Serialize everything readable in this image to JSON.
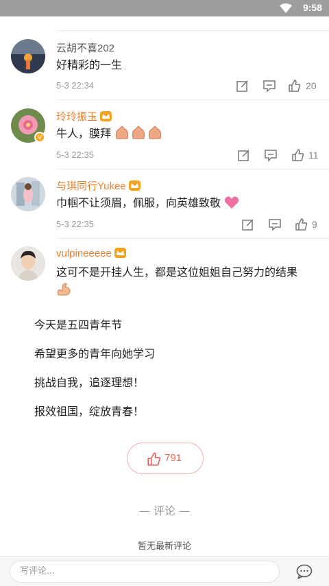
{
  "status_bar": {
    "time": "9:58"
  },
  "comments": [
    {
      "user": "云胡不喜202",
      "text": "好精彩的一生",
      "date": "5-3 22:34",
      "likes": "20"
    },
    {
      "user": "玲玲振玉",
      "text": "牛人，膜拜",
      "date": "5-3 22:35",
      "likes": "11"
    },
    {
      "user": "与琪同行Yukee",
      "text": "巾帼不让须眉，佩服，向英雄致敬",
      "date": "5-3 22:35",
      "likes": "9"
    },
    {
      "user": "vulpineeeee",
      "text": "这可不是开挂人生，都是这位姐姐自己努力的结果"
    }
  ],
  "post": {
    "lines": [
      "今天是五四青年节",
      "希望更多的青年向她学习",
      "挑战自我，追逐理想！",
      "报效祖国，绽放青春！"
    ],
    "like_count": "791"
  },
  "comments_section": {
    "title": "— 评论 —",
    "empty_text": "暂无最新评论"
  },
  "bottom_bar": {
    "input_placeholder": "写评论..."
  },
  "icons": [
    "wifi-icon",
    "edit-icon",
    "comment-icon",
    "thumbs-up-icon",
    "crown-badge-icon",
    "verified-badge-icon",
    "chat-bubble-icon"
  ],
  "colors": {
    "status_bar": "#9e9e9e",
    "vip_name": "#e8812f",
    "like_accent": "#e8615a"
  }
}
